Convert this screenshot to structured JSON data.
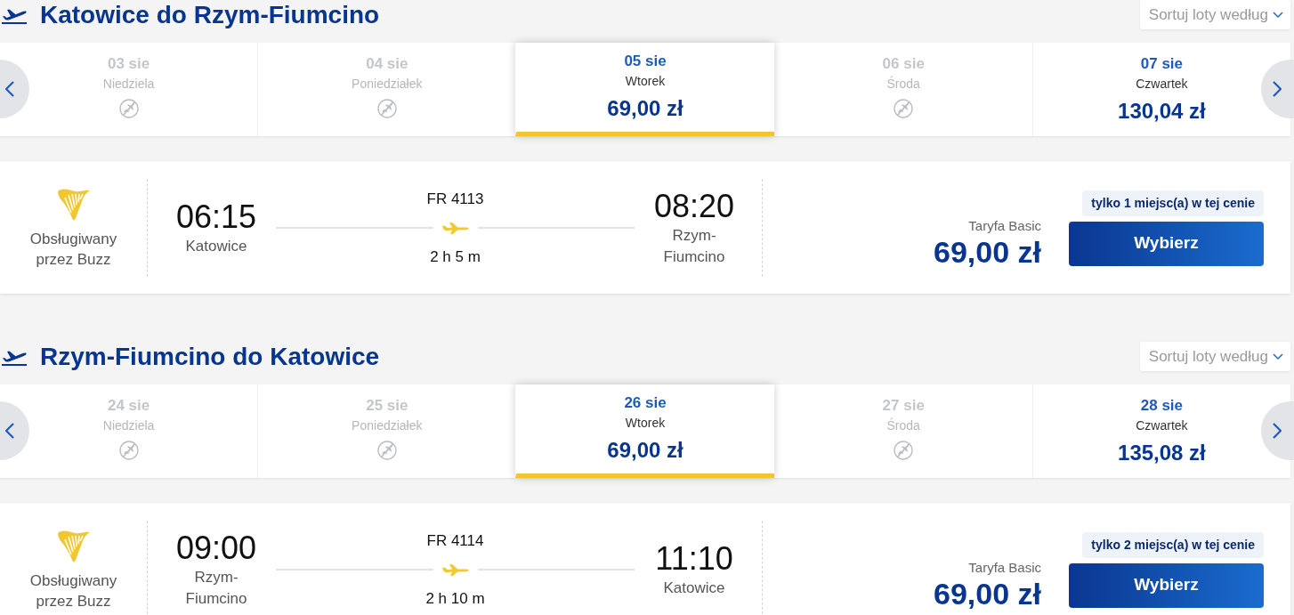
{
  "sections": [
    {
      "title": "Katowice do Rzym-Fiumcino",
      "sort_label": "Sortuj loty według",
      "dates": [
        {
          "date": "03 sie",
          "weekday": "Niedziela",
          "available": false,
          "selected": false
        },
        {
          "date": "04 sie",
          "weekday": "Poniedziałek",
          "available": false,
          "selected": false
        },
        {
          "date": "05 sie",
          "weekday": "Wtorek",
          "available": true,
          "selected": true,
          "price": "69,00 zł"
        },
        {
          "date": "06 sie",
          "weekday": "Środa",
          "available": false,
          "selected": false
        },
        {
          "date": "07 sie",
          "weekday": "Czwartek",
          "available": true,
          "selected": false,
          "price": "130,04 zł"
        }
      ],
      "flight": {
        "operator": "Obsługiwany przez Buzz",
        "departure_time": "06:15",
        "departure_city": "Katowice",
        "flight_number": "FR 4113",
        "duration": "2 h 5 m",
        "arrival_time": "08:20",
        "arrival_city": "Rzym-Fiumcino",
        "fare_label": "Taryfa Basic",
        "price": "69,00 zł",
        "seats_badge": "tylko 1 miejsc(a) w tej cenie",
        "button": "Wybierz"
      }
    },
    {
      "title": "Rzym-Fiumcino do Katowice",
      "sort_label": "Sortuj loty według",
      "dates": [
        {
          "date": "24 sie",
          "weekday": "Niedziela",
          "available": false,
          "selected": false
        },
        {
          "date": "25 sie",
          "weekday": "Poniedziałek",
          "available": false,
          "selected": false
        },
        {
          "date": "26 sie",
          "weekday": "Wtorek",
          "available": true,
          "selected": true,
          "price": "69,00 zł"
        },
        {
          "date": "27 sie",
          "weekday": "Środa",
          "available": false,
          "selected": false
        },
        {
          "date": "28 sie",
          "weekday": "Czwartek",
          "available": true,
          "selected": false,
          "price": "135,08 zł"
        }
      ],
      "flight": {
        "operator": "Obsługiwany przez Buzz",
        "departure_time": "09:00",
        "departure_city": "Rzym-Fiumcino",
        "flight_number": "FR 4114",
        "duration": "2 h 10 m",
        "arrival_time": "11:10",
        "arrival_city": "Katowice",
        "fare_label": "Taryfa Basic",
        "price": "69,00 zł",
        "seats_badge": "tylko 2 miejsc(a) w tej cenie",
        "button": "Wybierz"
      }
    }
  ]
}
